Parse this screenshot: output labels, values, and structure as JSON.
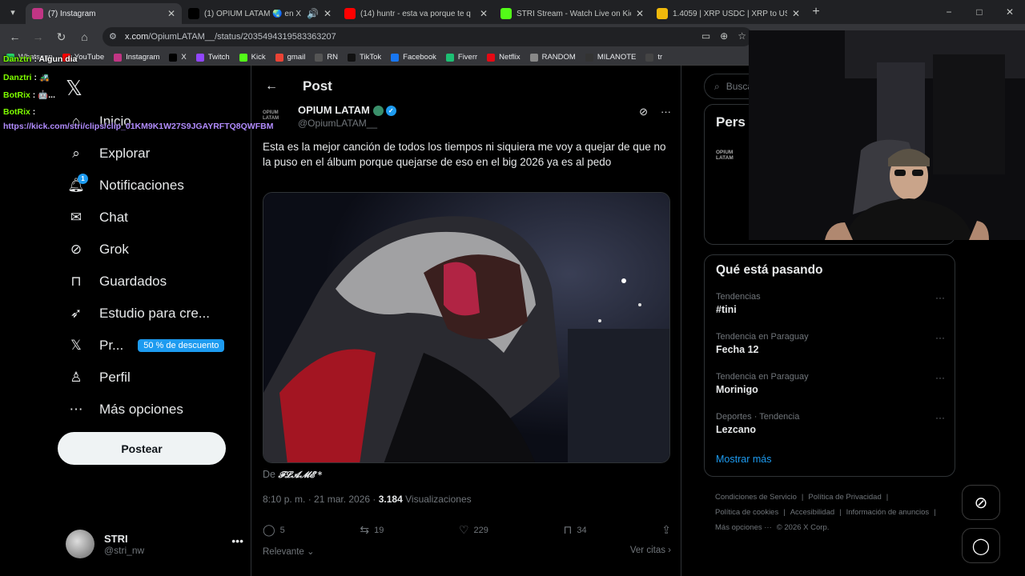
{
  "tabs": [
    {
      "title": "(7) Instagram",
      "favicon": "instagram-icon",
      "color": "#c13584",
      "active": true,
      "extra": ""
    },
    {
      "title": "(1) OPIUM LATAM 🌏 en X",
      "favicon": "x-icon",
      "color": "#000000",
      "active": false,
      "extra": "🔊"
    },
    {
      "title": "(14) huntr - esta va porque te q",
      "favicon": "youtube-icon",
      "color": "#ff0000",
      "active": false,
      "extra": ""
    },
    {
      "title": "STRI Stream - Watch Live on Kic",
      "favicon": "kick-icon",
      "color": "#53fc18",
      "active": false,
      "extra": ""
    },
    {
      "title": "1.4059 | XRP USDC | XRP to USD",
      "favicon": "binance-icon",
      "color": "#f0b90b",
      "active": false,
      "extra": ""
    }
  ],
  "window_controls": {
    "minimize": "−",
    "maximize": "□",
    "close": "✕"
  },
  "address": {
    "host": "x.com",
    "path": "/OpiumLATAM__/status/2035494319583363207"
  },
  "bookmarks": [
    {
      "label": "Whatsapp",
      "color": "#25d366"
    },
    {
      "label": "YouTube",
      "color": "#ff0000"
    },
    {
      "label": "Instagram",
      "color": "#c13584"
    },
    {
      "label": "X",
      "color": "#000000"
    },
    {
      "label": "Twitch",
      "color": "#9146ff"
    },
    {
      "label": "Kick",
      "color": "#53fc18"
    },
    {
      "label": "gmail",
      "color": "#ea4335"
    },
    {
      "label": "RN",
      "color": "#555555"
    },
    {
      "label": "TikTok",
      "color": "#111111"
    },
    {
      "label": "Facebook",
      "color": "#1877f2"
    },
    {
      "label": "Fiverr",
      "color": "#1dbf73"
    },
    {
      "label": "Netflix",
      "color": "#e50914"
    },
    {
      "label": "RANDOM",
      "color": "#888888"
    },
    {
      "label": "MILANOTE",
      "color": "#333333"
    },
    {
      "label": "tr",
      "color": "#444444"
    }
  ],
  "chat_overlay": [
    {
      "user": "Danztri",
      "message": "Algun dia",
      "color": "#7fff00"
    },
    {
      "user": "Danztri",
      "message": "🚜",
      "color": "#7fff00"
    },
    {
      "user": "BotRix",
      "message": "🤖...",
      "color": "#7fff00"
    },
    {
      "user": "BotRix",
      "message": "",
      "color": "#7fff00"
    },
    {
      "user": "",
      "message": "https://kick.com/stri/clips/clip_01KM9K1W27S9JGAYRFTQ8QWFBM",
      "color": "#b28cff"
    }
  ],
  "leftnav": {
    "items": [
      {
        "label": "Inicio",
        "icon": "home-icon"
      },
      {
        "label": "Explorar",
        "icon": "search-icon"
      },
      {
        "label": "Notificaciones",
        "icon": "bell-icon",
        "badge": "1"
      },
      {
        "label": "Chat",
        "icon": "mail-icon"
      },
      {
        "label": "Grok",
        "icon": "grok-icon"
      },
      {
        "label": "Guardados",
        "icon": "bookmark-icon"
      },
      {
        "label": "Estudio para cre...",
        "icon": "rocket-icon"
      },
      {
        "label": "Pr...",
        "icon": "x-premium-icon",
        "discount": "50 % de descuento"
      },
      {
        "label": "Perfil",
        "icon": "person-icon"
      },
      {
        "label": "Más opciones",
        "icon": "more-circle-icon"
      }
    ],
    "post_button": "Postear",
    "account": {
      "name": "STRI",
      "handle": "@stri_nw"
    }
  },
  "post": {
    "header": "Post",
    "author_logo": "OPIUM LATAM",
    "author_name": "OPIUM LATAM",
    "author_handle": "@OpiumLATAM__",
    "text": "Esta es la mejor canción de todos los tiempos ni siquiera me voy a quejar de que no la puso en el álbum porque quejarse de eso en el big 2026 ya es al pedo",
    "from_prefix": "De",
    "from_name": "𝓕𝓛𝓐𝓜𝓔 *",
    "time": "8:10 p. m. · 21 mar. 2026 ·",
    "views_count": "3.184",
    "views_label": "Visualizaciones",
    "replies": "5",
    "reposts": "19",
    "likes": "229",
    "bookmarks": "34",
    "sort_label": "Relevante",
    "quotes_label": "Ver citas"
  },
  "right": {
    "search_placeholder": "Buscar",
    "premium_title": "Pers",
    "premium_logo": "OPIUM LATAM",
    "trends_title": "Qué está pasando",
    "trends": [
      {
        "context": "Tendencias",
        "name": "#tini"
      },
      {
        "context": "Tendencia en Paraguay",
        "name": "Fecha 12"
      },
      {
        "context": "Tendencia en Paraguay",
        "name": "Morinigo"
      },
      {
        "context": "Deportes · Tendencia",
        "name": "Lezcano"
      }
    ],
    "show_more": "Mostrar más",
    "footer_links": [
      "Condiciones de Servicio",
      "|",
      "Política de Privacidad",
      "|",
      "Política de cookies",
      "|",
      "Accesibilidad",
      "|",
      "Información de anuncios",
      "|",
      "Más opciones ···",
      "© 2026 X Corp."
    ]
  },
  "colors": {
    "accent": "#1d9bf0",
    "bg": "#000000",
    "border": "#2f3336",
    "muted": "#71767b"
  }
}
